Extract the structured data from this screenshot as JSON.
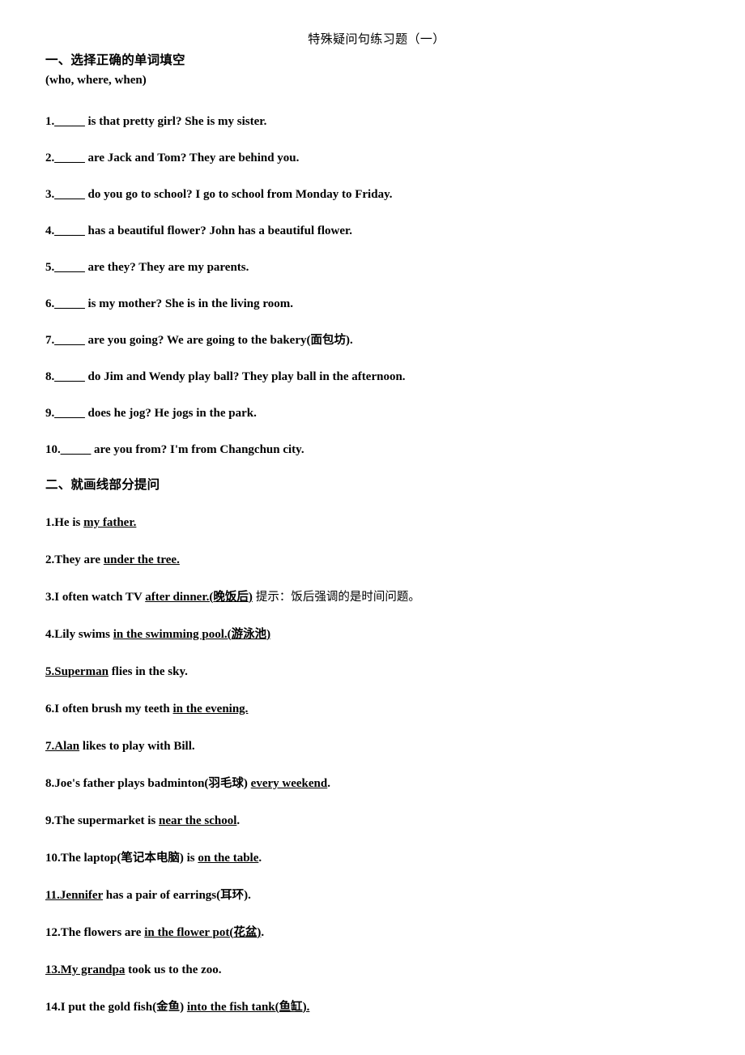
{
  "document": {
    "title": "特殊疑问句练习题（一）"
  },
  "section1": {
    "heading": "一、选择正确的单词填空",
    "word_bank": "(who, where, when)",
    "blank": "_____",
    "items": [
      {
        "number": "1.",
        "text": " is that pretty girl? She is my sister."
      },
      {
        "number": "2.",
        "text": " are Jack and Tom? They are behind you."
      },
      {
        "number": "3.",
        "text": " do you go to school? I go to school from Monday to Friday."
      },
      {
        "number": "4.",
        "text": " has a beautiful flower? John has a beautiful flower."
      },
      {
        "number": "5.",
        "text": " are they? They are my parents."
      },
      {
        "number": "6.",
        "text": " is my mother? She is in the living room."
      },
      {
        "number": "7.",
        "text": " are you going? We are going to the bakery(面包坊)."
      },
      {
        "number": "8.",
        "text": " do Jim and Wendy play ball? They play ball in the afternoon."
      },
      {
        "number": "9.",
        "text": " does he jog? He jogs in the park."
      },
      {
        "number": "10.",
        "text": " are you from? I'm from Changchun city."
      }
    ]
  },
  "section2": {
    "heading": "二、就画线部分提问",
    "items": [
      {
        "id": "s2-1",
        "lead": "1.He is ",
        "underlined": "my father.",
        "tail": "",
        "hint": ""
      },
      {
        "id": "s2-2",
        "lead": "2.They are ",
        "underlined": "under the tree.",
        "tail": "",
        "hint": ""
      },
      {
        "id": "s2-3",
        "lead": "3.I often watch TV ",
        "underlined": "after dinner.(晚饭后)",
        "tail": "",
        "hint": "提示：饭后强调的是时间问题。"
      },
      {
        "id": "s2-4",
        "lead": "4.Lily swims ",
        "underlined": "in the swimming pool.(游泳池)",
        "tail": "",
        "hint": ""
      },
      {
        "id": "s2-5",
        "lead": "",
        "underlined": "5.Superman",
        "tail": " flies in the sky.",
        "hint": ""
      },
      {
        "id": "s2-6",
        "lead": "6.I often brush my teeth ",
        "underlined": "in the evening.",
        "tail": "",
        "hint": ""
      },
      {
        "id": "s2-7",
        "lead": "",
        "underlined": "7.Alan",
        "tail": " likes to play with Bill.",
        "hint": ""
      },
      {
        "id": "s2-8",
        "lead": "8.Joe's father plays badminton(羽毛球) ",
        "underlined": "every weekend",
        "tail": ".",
        "hint": ""
      },
      {
        "id": "s2-9",
        "lead": "9.The supermarket is ",
        "underlined": "near the school",
        "tail": ".",
        "hint": ""
      },
      {
        "id": "s2-10",
        "lead": "10.The laptop(笔记本电脑) is ",
        "underlined": "on the table",
        "tail": ".",
        "hint": ""
      },
      {
        "id": "s2-11",
        "lead": "",
        "underlined": "11.Jennifer",
        "tail": " has a pair of earrings(耳环).",
        "hint": ""
      },
      {
        "id": "s2-12",
        "lead": "12.The flowers are ",
        "underlined": "in the flower pot(花盆)",
        "tail": ".",
        "hint": ""
      },
      {
        "id": "s2-13",
        "lead": "",
        "underlined": "13.My grandpa",
        "tail": " took us to the zoo.",
        "hint": ""
      },
      {
        "id": "s2-14",
        "lead": "14.I put the gold fish(金鱼) ",
        "underlined": "into the fish tank(鱼缸).",
        "tail": "",
        "hint": ""
      }
    ]
  },
  "colors": {
    "page_background": "#ffffff",
    "text": "#000000"
  }
}
